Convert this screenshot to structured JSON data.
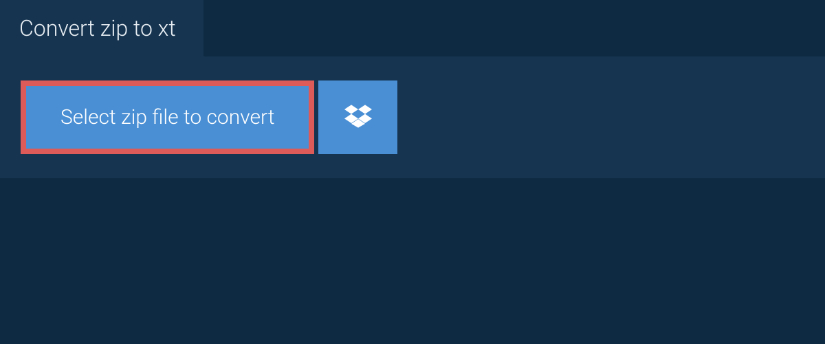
{
  "tab": {
    "title": "Convert zip to xt"
  },
  "actions": {
    "select_file_label": "Select zip file to convert"
  },
  "colors": {
    "page_bg": "#0e2a42",
    "panel_bg": "#163450",
    "button_bg": "#4a8fd4",
    "highlight_border": "#dd5c59"
  }
}
